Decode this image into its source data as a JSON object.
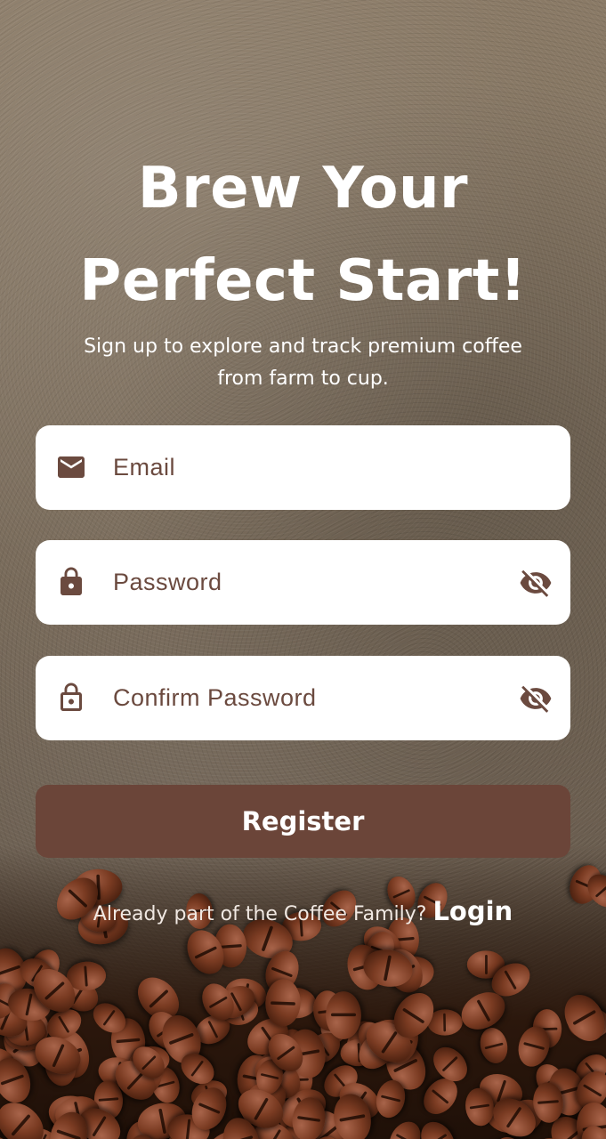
{
  "hero": {
    "title_line1": "Brew Your",
    "title_line2": "Perfect Start!",
    "subtitle_line1": "Sign up to explore and track premium coffee",
    "subtitle_line2": "from farm to cup."
  },
  "form": {
    "email": {
      "placeholder": "Email",
      "icon": "mail-icon"
    },
    "password": {
      "placeholder": "Password",
      "icon": "lock-icon",
      "toggle_icon": "eye-off-icon"
    },
    "confirm_password": {
      "placeholder": "Confirm Password",
      "icon": "lock-outline-icon",
      "toggle_icon": "eye-off-icon"
    }
  },
  "actions": {
    "register_label": "Register"
  },
  "footer": {
    "prompt": "Already part of the Coffee Family?",
    "login_label": "Login"
  },
  "colors": {
    "primary_brown": "#6b4539",
    "icon_brown": "#6b4a3f",
    "field_bg": "#ffffff",
    "text_light": "#ffffff"
  }
}
